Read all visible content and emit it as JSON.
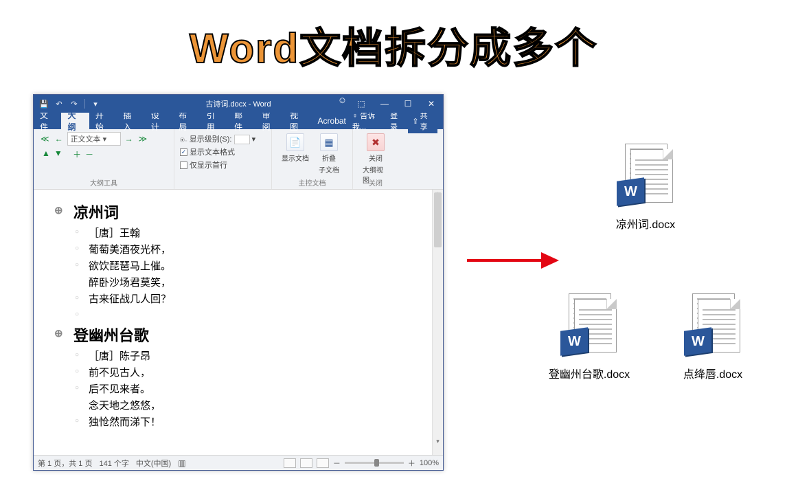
{
  "headline": "Word文档拆分成多个",
  "window": {
    "title": "古诗词.docx - Word",
    "tabs": [
      "文件",
      "大纲",
      "开始",
      "插入",
      "设计",
      "布局",
      "引用",
      "邮件",
      "审阅",
      "视图",
      "Acrobat"
    ],
    "active_tab_index": 1,
    "tell_me": "告诉我...",
    "signin": "登录",
    "share": "共享"
  },
  "ribbon": {
    "level_select": "正文文本",
    "show_level_label": "显示级别(S):",
    "chk_show_format": "显示文本格式",
    "chk_first_line": "仅显示首行",
    "group1_label": "大纲工具",
    "btn_show_doc": "显示文档",
    "btn_collapse": "折叠",
    "btn_collapse_sub": "子文档",
    "group2_label": "主控文档",
    "btn_close": "关闭",
    "btn_close_sub": "大纲视图",
    "group3_label": "关闭"
  },
  "doc": {
    "poem1_title": "凉州词",
    "poem1_lines": [
      "［唐］王翰",
      "葡萄美酒夜光杯，",
      "欲饮琵琶马上催。",
      "醉卧沙场君莫笑，",
      "古来征战几人回？"
    ],
    "poem2_title": "登幽州台歌",
    "poem2_lines": [
      "［唐］陈子昂",
      "前不见古人，",
      "后不见来者。",
      "念天地之悠悠，",
      "独怆然而涕下！"
    ]
  },
  "status": {
    "page": "第 1 页，共 1 页",
    "words": "141 个字",
    "lang": "中文(中国)",
    "zoom": "100%"
  },
  "files": {
    "f1": "凉州词.docx",
    "f2": "登幽州台歌.docx",
    "f3": "点绛唇.docx"
  }
}
